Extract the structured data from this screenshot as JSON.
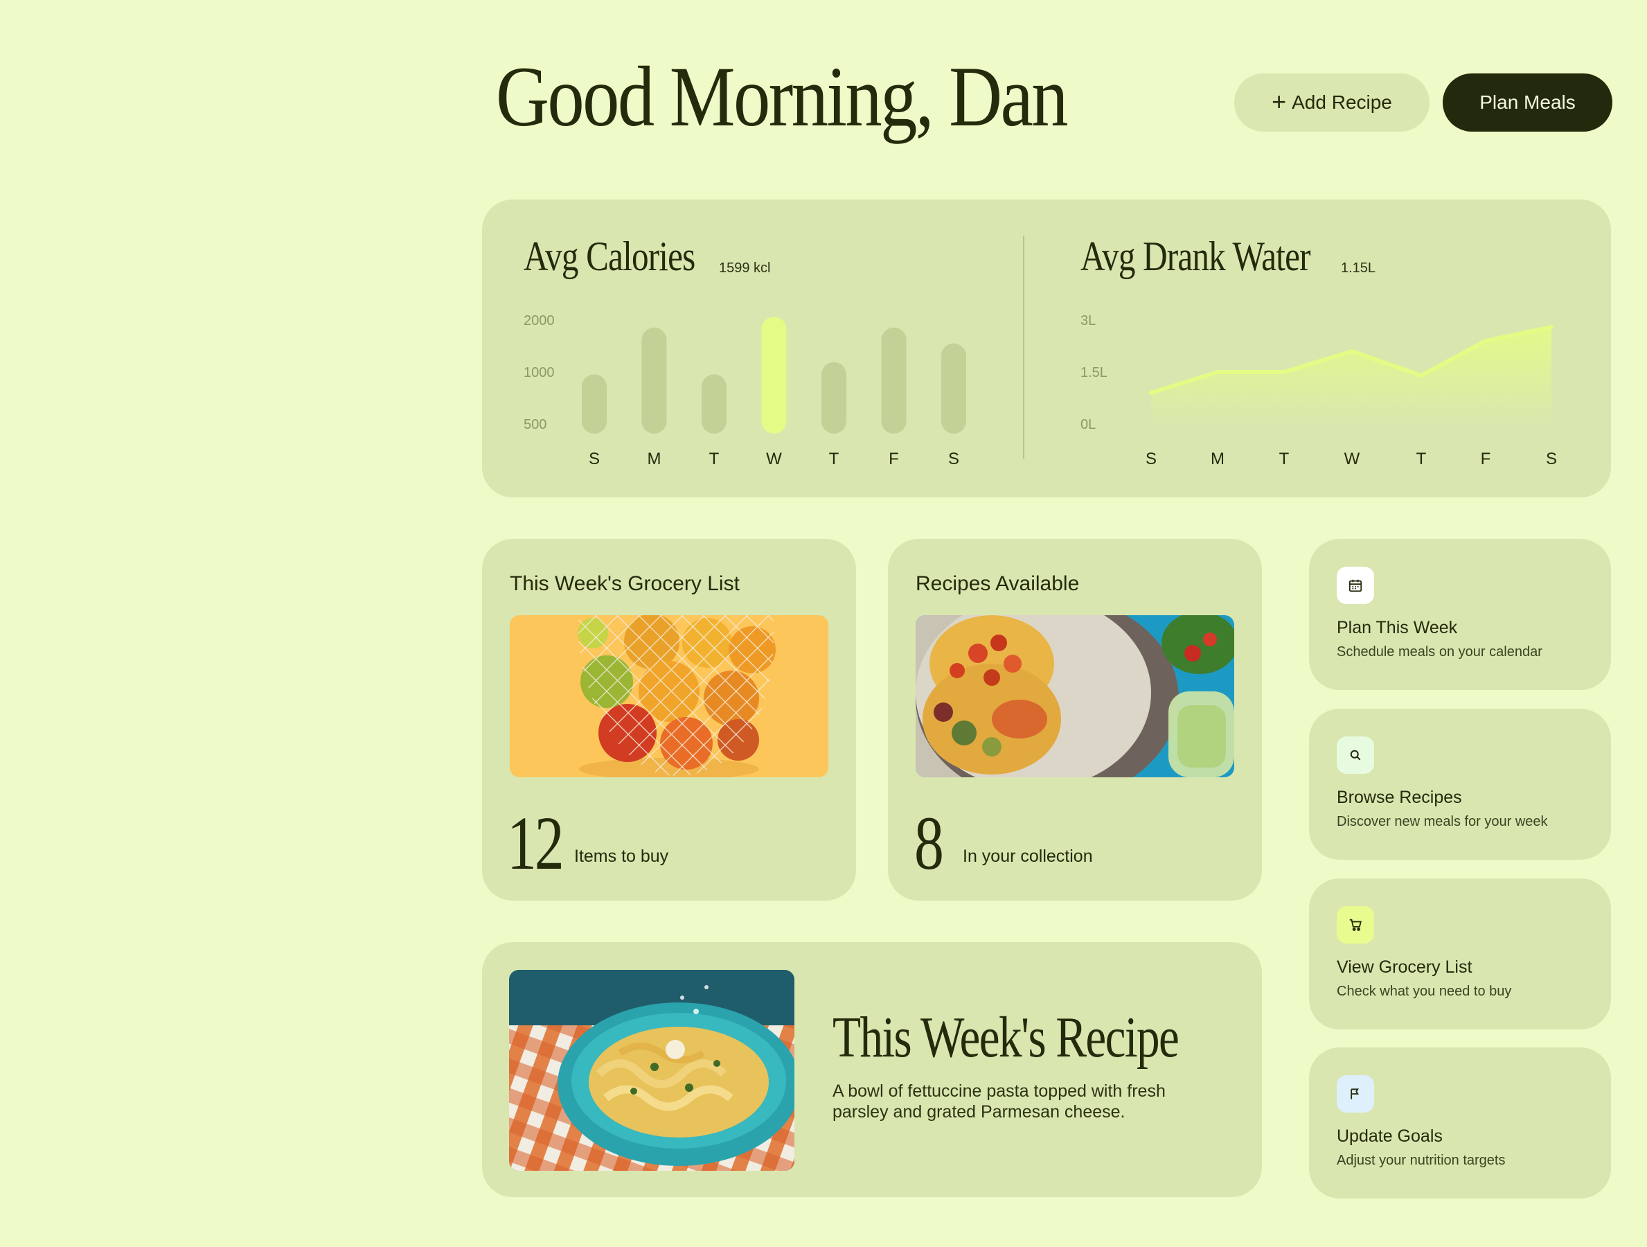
{
  "header": {
    "greeting": "Good Morning, Dan",
    "add_recipe_label": "Add Recipe",
    "plan_meals_label": "Plan Meals"
  },
  "colors": {
    "background": "#eefac8",
    "card": "#d9e6b0",
    "bar": "#c3d196",
    "bar_highlight": "#e4fb85",
    "line": "#e4fb85",
    "dark": "#23290c"
  },
  "calories": {
    "title": "Avg Calories",
    "value": "1599 kcl",
    "chart_data": {
      "type": "bar",
      "categories": [
        "S",
        "M",
        "T",
        "W",
        "T",
        "F",
        "S"
      ],
      "values": [
        1150,
        1800,
        1150,
        1950,
        1320,
        1800,
        1580
      ],
      "highlight_index": 3,
      "yticks": [
        "2000",
        "1000",
        "500"
      ],
      "ylim": [
        0,
        2000
      ],
      "grid": false
    }
  },
  "water": {
    "title": "Avg Drank Water",
    "value": "1.15L",
    "chart_data": {
      "type": "area",
      "categories": [
        "S",
        "M",
        "T",
        "W",
        "T",
        "F",
        "S"
      ],
      "values": [
        0.9,
        1.5,
        1.5,
        2.1,
        1.4,
        2.4,
        2.8
      ],
      "yticks": [
        "3L",
        "1.5L",
        "0L"
      ],
      "ylim": [
        0,
        3
      ],
      "grid": false
    }
  },
  "grocery": {
    "title": "This Week's Grocery List",
    "count": "12",
    "label": "Items to buy"
  },
  "recipes": {
    "title": "Recipes Available",
    "count": "8",
    "label": "In your collection"
  },
  "featured": {
    "title": "This Week's Recipe",
    "description": "A bowl of fettuccine pasta topped with fresh parsley and grated Parmesan cheese."
  },
  "actions": [
    {
      "title": "Plan This Week",
      "subtitle": "Schedule meals on your calendar",
      "icon": "calendar-icon",
      "icon_bg": "#ffffff"
    },
    {
      "title": "Browse Recipes",
      "subtitle": "Discover new meals for your week",
      "icon": "search-icon",
      "icon_bg": "#e6fbe0"
    },
    {
      "title": "View Grocery List",
      "subtitle": "Check what you need to buy",
      "icon": "cart-icon",
      "icon_bg": "#e8fb8e"
    },
    {
      "title": "Update Goals",
      "subtitle": "Adjust your nutrition targets",
      "icon": "flag-icon",
      "icon_bg": "#ddf0fb"
    }
  ]
}
